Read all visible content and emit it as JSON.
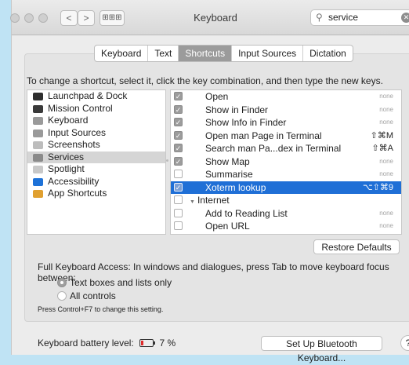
{
  "window": {
    "title": "Keyboard"
  },
  "toolbar": {
    "back": "<",
    "forward": ">",
    "grid": "⊞⊞⊞"
  },
  "search": {
    "value": "service"
  },
  "tabs": [
    "Keyboard",
    "Text",
    "Shortcuts",
    "Input Sources",
    "Dictation"
  ],
  "active_tab": "Shortcuts",
  "instruction": "To change a shortcut, select it, click the key combination, and then type the new keys.",
  "categories": [
    {
      "label": "Launchpad & Dock",
      "icon": "launchpad-icon",
      "color": "#2d2d2d"
    },
    {
      "label": "Mission Control",
      "icon": "mission-control-icon",
      "color": "#3a3a3a"
    },
    {
      "label": "Keyboard",
      "icon": "keyboard-icon",
      "color": "#9a9a9a"
    },
    {
      "label": "Input Sources",
      "icon": "input-sources-icon",
      "color": "#9a9a9a"
    },
    {
      "label": "Screenshots",
      "icon": "screenshots-icon",
      "color": "#bdbdbd"
    },
    {
      "label": "Services",
      "icon": "gear-icon",
      "color": "#8a8a8a"
    },
    {
      "label": "Spotlight",
      "icon": "spotlight-icon",
      "color": "#c8c8c8"
    },
    {
      "label": "Accessibility",
      "icon": "accessibility-icon",
      "color": "#1e72d8"
    },
    {
      "label": "App Shortcuts",
      "icon": "app-shortcuts-icon",
      "color": "#e0a030"
    }
  ],
  "selected_category": "Services",
  "services": [
    {
      "name": "Open",
      "shortcut": "none",
      "checked": true
    },
    {
      "name": "Show in Finder",
      "shortcut": "none",
      "checked": true
    },
    {
      "name": "Show Info in Finder",
      "shortcut": "none",
      "checked": true
    },
    {
      "name": "Open man Page in Terminal",
      "shortcut": "⇧⌘M",
      "checked": true
    },
    {
      "name": "Search man Pa...dex in Terminal",
      "shortcut": "⇧⌘A",
      "checked": true
    },
    {
      "name": "Show Map",
      "shortcut": "none",
      "checked": true
    },
    {
      "name": "Summarise",
      "shortcut": "none",
      "checked": false
    },
    {
      "name": "Xoterm lookup",
      "shortcut": "⌥⇧⌘9",
      "checked": true,
      "selected": true
    },
    {
      "name": "Internet",
      "shortcut": "",
      "checked": false,
      "group": true
    },
    {
      "name": "Add to Reading List",
      "shortcut": "none",
      "checked": false
    },
    {
      "name": "Open URL",
      "shortcut": "none",
      "checked": false
    }
  ],
  "restore_defaults": "Restore Defaults",
  "keyboard_access": {
    "text": "Full Keyboard Access: In windows and dialogues, press Tab to move keyboard focus between:",
    "options": [
      "Text boxes and lists only",
      "All controls"
    ],
    "selected": 0,
    "hint": "Press Control+F7 to change this setting."
  },
  "battery": {
    "label": "Keyboard battery level:",
    "value": "7 %"
  },
  "bluetooth_button": "Set Up Bluetooth Keyboard...",
  "help": "?"
}
